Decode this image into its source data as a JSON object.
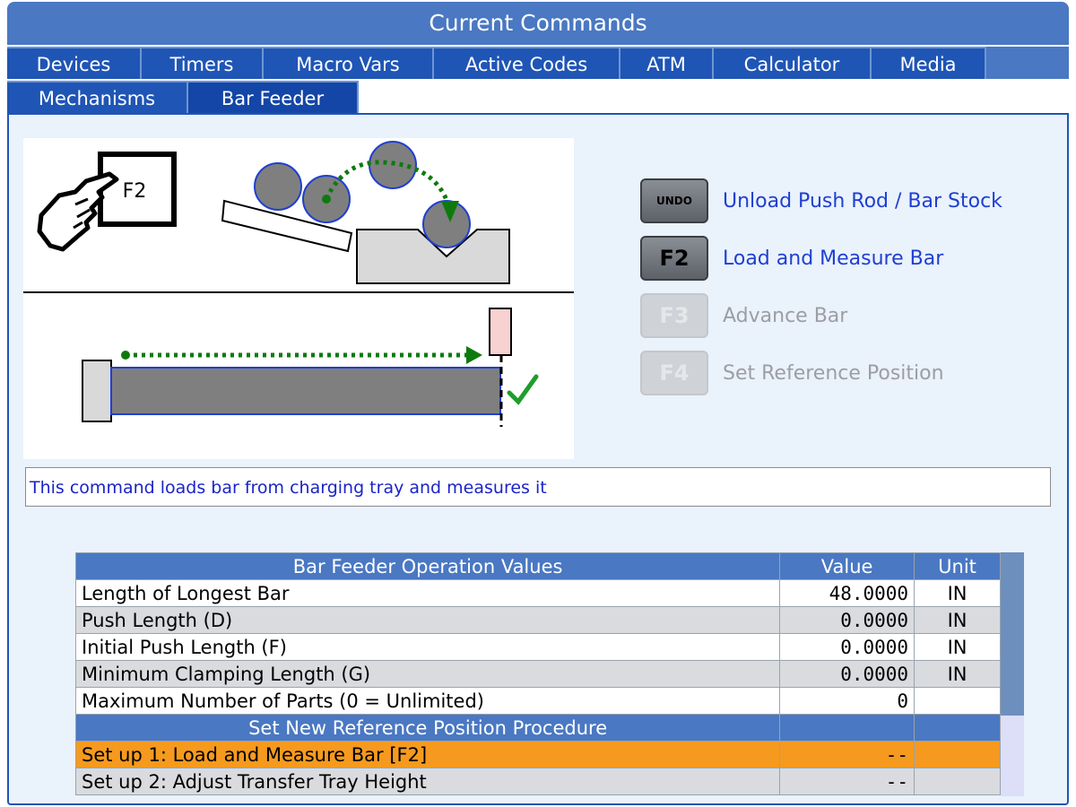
{
  "window_title": "Current Commands",
  "tabs_row1": [
    "Devices",
    "Timers",
    "Macro Vars",
    "Active Codes",
    "ATM",
    "Calculator",
    "Media"
  ],
  "tabs_row2": [
    "Mechanisms",
    "Bar Feeder"
  ],
  "selected_tab": "Bar Feeder",
  "diagram": {
    "key_label": "F2"
  },
  "commands": [
    {
      "key": "UNDO",
      "label": "Unload Push Rod / Bar Stock",
      "enabled": true
    },
    {
      "key": "F2",
      "label": "Load and Measure Bar",
      "enabled": true
    },
    {
      "key": "F3",
      "label": "Advance Bar",
      "enabled": false
    },
    {
      "key": "F4",
      "label": "Set Reference Position",
      "enabled": false
    }
  ],
  "description": "This command loads bar from charging tray and measures it",
  "table": {
    "headers": [
      "Bar Feeder Operation Values",
      "Value",
      "Unit"
    ],
    "rows": [
      {
        "name": "Length of Longest Bar",
        "value": "48.0000",
        "unit": "IN"
      },
      {
        "name": "Push Length (D)",
        "value": "0.0000",
        "unit": "IN"
      },
      {
        "name": "Initial Push Length (F)",
        "value": "0.0000",
        "unit": "IN"
      },
      {
        "name": "Minimum Clamping Length (G)",
        "value": "0.0000",
        "unit": "IN"
      },
      {
        "name": "Maximum Number of Parts (0 = Unlimited)",
        "value": "0",
        "unit": ""
      }
    ],
    "section_title": "Set New Reference Position Procedure",
    "procedure": [
      {
        "name": "Set up 1: Load and Measure Bar [F2]",
        "value": "--",
        "highlighted": true
      },
      {
        "name": "Set up 2: Adjust Transfer Tray Height",
        "value": "--",
        "highlighted": false
      }
    ]
  },
  "colors": {
    "header_blue": "#4a78c2",
    "tab_blue": "#1f55b5",
    "highlight_orange": "#f59a1f",
    "link_blue": "#1f3fd1",
    "arrow_green": "#0e7a0e"
  }
}
